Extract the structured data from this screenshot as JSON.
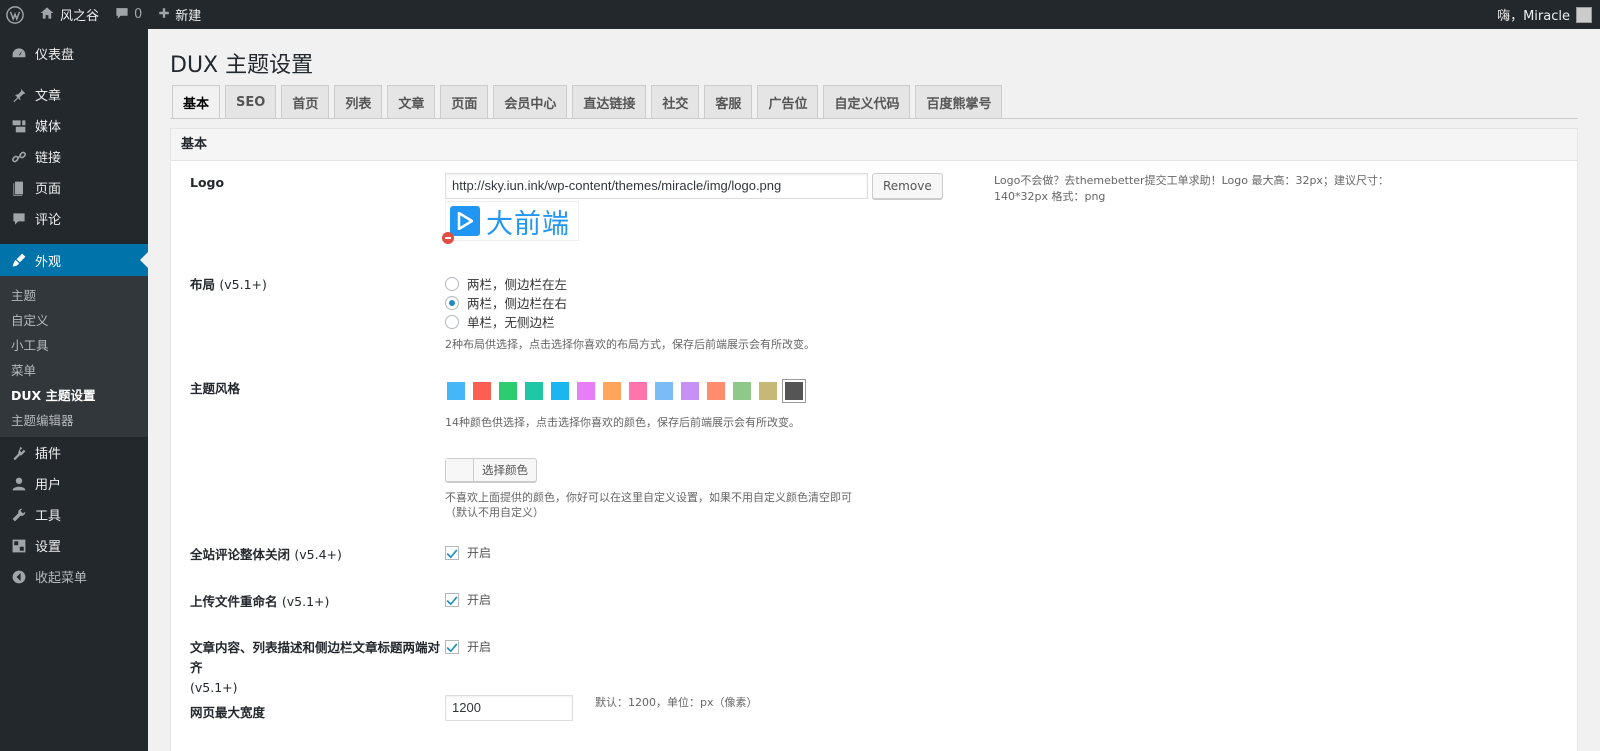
{
  "adminbar": {
    "site_name": "风之谷",
    "comments_count": "0",
    "new_label": "新建",
    "greeting": "嗨，Miracle"
  },
  "sidebar": {
    "items": [
      {
        "label": "仪表盘",
        "icon": "dashboard-icon"
      },
      {
        "label": "文章",
        "icon": "pin-icon"
      },
      {
        "label": "媒体",
        "icon": "media-icon"
      },
      {
        "label": "链接",
        "icon": "link-icon"
      },
      {
        "label": "页面",
        "icon": "page-icon"
      },
      {
        "label": "评论",
        "icon": "comment-icon"
      },
      {
        "label": "外观",
        "icon": "appearance-icon"
      },
      {
        "label": "插件",
        "icon": "plugin-icon"
      },
      {
        "label": "用户",
        "icon": "user-icon"
      },
      {
        "label": "工具",
        "icon": "tool-icon"
      },
      {
        "label": "设置",
        "icon": "settings-icon"
      },
      {
        "label": "收起菜单",
        "icon": "collapse-icon"
      }
    ],
    "submenu": [
      "主题",
      "自定义",
      "小工具",
      "菜单",
      "DUX 主题设置",
      "主题编辑器"
    ]
  },
  "page": {
    "title": "DUX 主题设置",
    "tabs": [
      "基本",
      "SEO",
      "首页",
      "列表",
      "文章",
      "页面",
      "会员中心",
      "直达链接",
      "社交",
      "客服",
      "广告位",
      "自定义代码",
      "百度熊掌号"
    ],
    "panel_title": "基本"
  },
  "fields": {
    "logo": {
      "label": "Logo",
      "value": "http://sky.iun.ink/wp-content/themes/miracle/img/logo.png",
      "remove_label": "Remove",
      "preview_text": "大前端",
      "desc": "Logo不会做？去themebetter提交工单求助！Logo 最大高：32px；建议尺寸：140*32px 格式：png"
    },
    "layout": {
      "label": "布局",
      "version": "(v5.1+)",
      "options": [
        "两栏，侧边栏在左",
        "两栏，侧边栏在右",
        "单栏，无侧边栏"
      ],
      "selected_index": 1,
      "desc": "2种布局供选择，点击选择你喜欢的布局方式，保存后前端展示会有所改变。"
    },
    "theme_style": {
      "label": "主题风格",
      "colors": [
        "#45b6f7",
        "#ff5e52",
        "#2ecc71",
        "#1fc7a6",
        "#1bb5f0",
        "#e87ef7",
        "#ffa65c",
        "#ff74aa",
        "#7bbcf7",
        "#c690f7",
        "#ff8d6e",
        "#8fc98a",
        "#c6b978",
        "#555555"
      ],
      "selected_index": 13,
      "desc": "14种颜色供选择，点击选择你喜欢的颜色，保存后前端展示会有所改变。",
      "picker_label": "选择颜色",
      "custom_desc_line1": "不喜欢上面提供的颜色，你好可以在这里自定义设置，如果不用自定义颜色清空即可",
      "custom_desc_line2": "（默认不用自定义）"
    },
    "close_comments": {
      "label": "全站评论整体关闭",
      "version": "(v5.4+)",
      "option": "开启"
    },
    "rename_upload": {
      "label": "上传文件重命名",
      "version": "(v5.1+)",
      "option": "开启"
    },
    "justify_text": {
      "label": "文章内容、列表描述和侧边栏文章标题两端对齐",
      "version": "(v5.1+)",
      "option": "开启"
    },
    "max_width": {
      "label": "网页最大宽度",
      "value": "1200",
      "desc": "默认：1200，单位：px（像素）"
    }
  }
}
